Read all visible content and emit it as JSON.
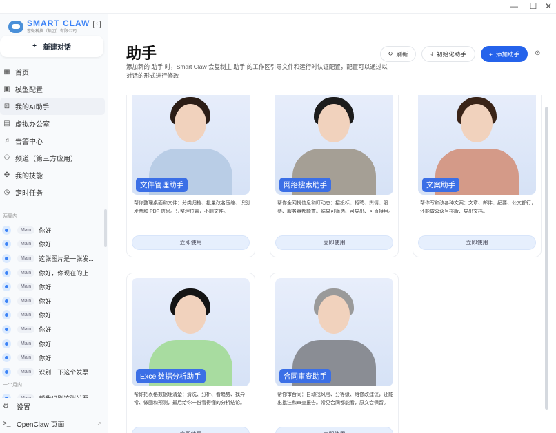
{
  "window": {
    "minimize": "—",
    "maximize": "☐",
    "close": "✕"
  },
  "logo": {
    "name": "SMART CLAW",
    "company": "志微科技（集团）有限公司"
  },
  "sidebar": {
    "new_chat": "新建对话",
    "nav": [
      {
        "label": "首页",
        "icon": "grid-icon",
        "glyph": "▦"
      },
      {
        "label": "模型配置",
        "icon": "chip-icon",
        "glyph": "▣"
      },
      {
        "label": "我的AI助手",
        "icon": "robot-icon",
        "glyph": "⊡"
      },
      {
        "label": "虚拟办公室",
        "icon": "building-icon",
        "glyph": "▤"
      },
      {
        "label": "告警中心",
        "icon": "bell-icon",
        "glyph": "♫"
      },
      {
        "label": "频道（第三方应用）",
        "icon": "network-icon",
        "glyph": "⚇"
      },
      {
        "label": "我的技能",
        "icon": "puzzle-icon",
        "glyph": "✣"
      },
      {
        "label": "定时任务",
        "icon": "clock-icon",
        "glyph": "◷"
      }
    ],
    "section_week": "两周内",
    "history": [
      {
        "tag": "Main",
        "title": "你好"
      },
      {
        "tag": "Main",
        "title": "你好"
      },
      {
        "tag": "Main",
        "title": "这张图片是一张发..."
      },
      {
        "tag": "Main",
        "title": "你好，你现在的上..."
      },
      {
        "tag": "Main",
        "title": "你好"
      },
      {
        "tag": "Main",
        "title": "你好!"
      },
      {
        "tag": "Main",
        "title": "你好"
      },
      {
        "tag": "Main",
        "title": "你好"
      },
      {
        "tag": "Main",
        "title": "你好"
      },
      {
        "tag": "Main",
        "title": "你好"
      },
      {
        "tag": "Main",
        "title": "识别一下这个发票..."
      }
    ],
    "section_month": "一个月内",
    "month_history": [
      {
        "tag": "Main",
        "title": "帮我识别这张发票"
      }
    ],
    "settings": "设置",
    "openclaw": "OpenClaw 页面"
  },
  "header": {
    "title": "助手",
    "description": "添加新的 助手 时，Smart Claw 会复制主 助手 的工作区引导文件和运行时认证配置，配置可以通过以对话的形式进行修改",
    "refresh": "刷新",
    "init": "初始化助手",
    "add": "添加助手"
  },
  "cards": [
    {
      "name": "文件管理助手",
      "desc": "帮你整理桌面和文件：分类归档、批量改名压缩、识别发票和 PDF 信息。只整理位置，不删文件。",
      "button": "立即使用",
      "hair": "#2b1d16",
      "shirt": "#b9cde6"
    },
    {
      "name": "网络搜索助手",
      "desc": "帮你全网找信息和盯动态：招投标、招聘、舆情、股票、服务器都能查。结果可筛选、可导出、可直接用。",
      "button": "立即使用",
      "hair": "#1c1c1c",
      "shirt": "#a59f95"
    },
    {
      "name": "文案助手",
      "desc": "帮你写和改各种文案：文章、邮件、纪要、公文都行，还能做公众号排版、导出文档。",
      "button": "立即使用",
      "hair": "#3a2418",
      "shirt": "#d49a88"
    },
    {
      "name": "Excel数据分析助手",
      "desc": "帮你把表格数据理清楚：清洗、分析、看趋势、找异常、做图和预测，最后给你一份看得懂的分析结论。",
      "button": "立即使用",
      "hair": "#141414",
      "shirt": "#a8dca0"
    },
    {
      "name": "合同审查助手",
      "desc": "帮你审合同：自动找风险、分等级、给修改建议，还能出批注和审查报告。常见合同都能看，原文会保留。",
      "button": "立即使用",
      "hair": "#9a9a9a",
      "shirt": "#8a8d94"
    }
  ]
}
